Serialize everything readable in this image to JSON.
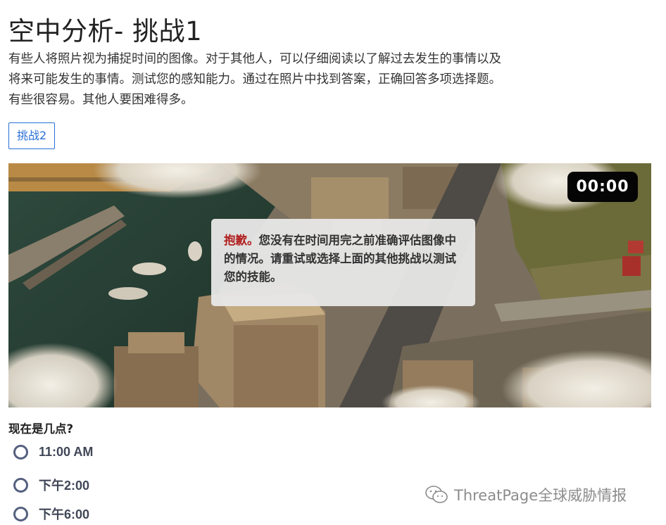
{
  "page": {
    "title": "空中分析- 挑战1",
    "intro": "有些人将照片视为捕捉时间的图像。对于其他人，可以仔细阅读以了解过去发生的事情以及将来可能发生的事情。测试您的感知能力。通过在照片中找到答案，正确回答多项选择题。有些很容易。其他人要困难得多。",
    "challenge_button": "挑战2"
  },
  "scene": {
    "timer": "00:00",
    "notice_prefix": "抱歉。",
    "notice_text": "您没有在时间用完之前准确评估图像中的情况。请重试或选择上面的其他挑战以测试您的技能。",
    "notice_prefix_color": "#b11d1d"
  },
  "quiz": {
    "question": "现在是几点?",
    "options": [
      "11:00 AM",
      "下午2:00",
      "下午6:00"
    ]
  },
  "watermark": {
    "icon": "wechat-icon",
    "text": "ThreatPage全球威胁情报"
  }
}
